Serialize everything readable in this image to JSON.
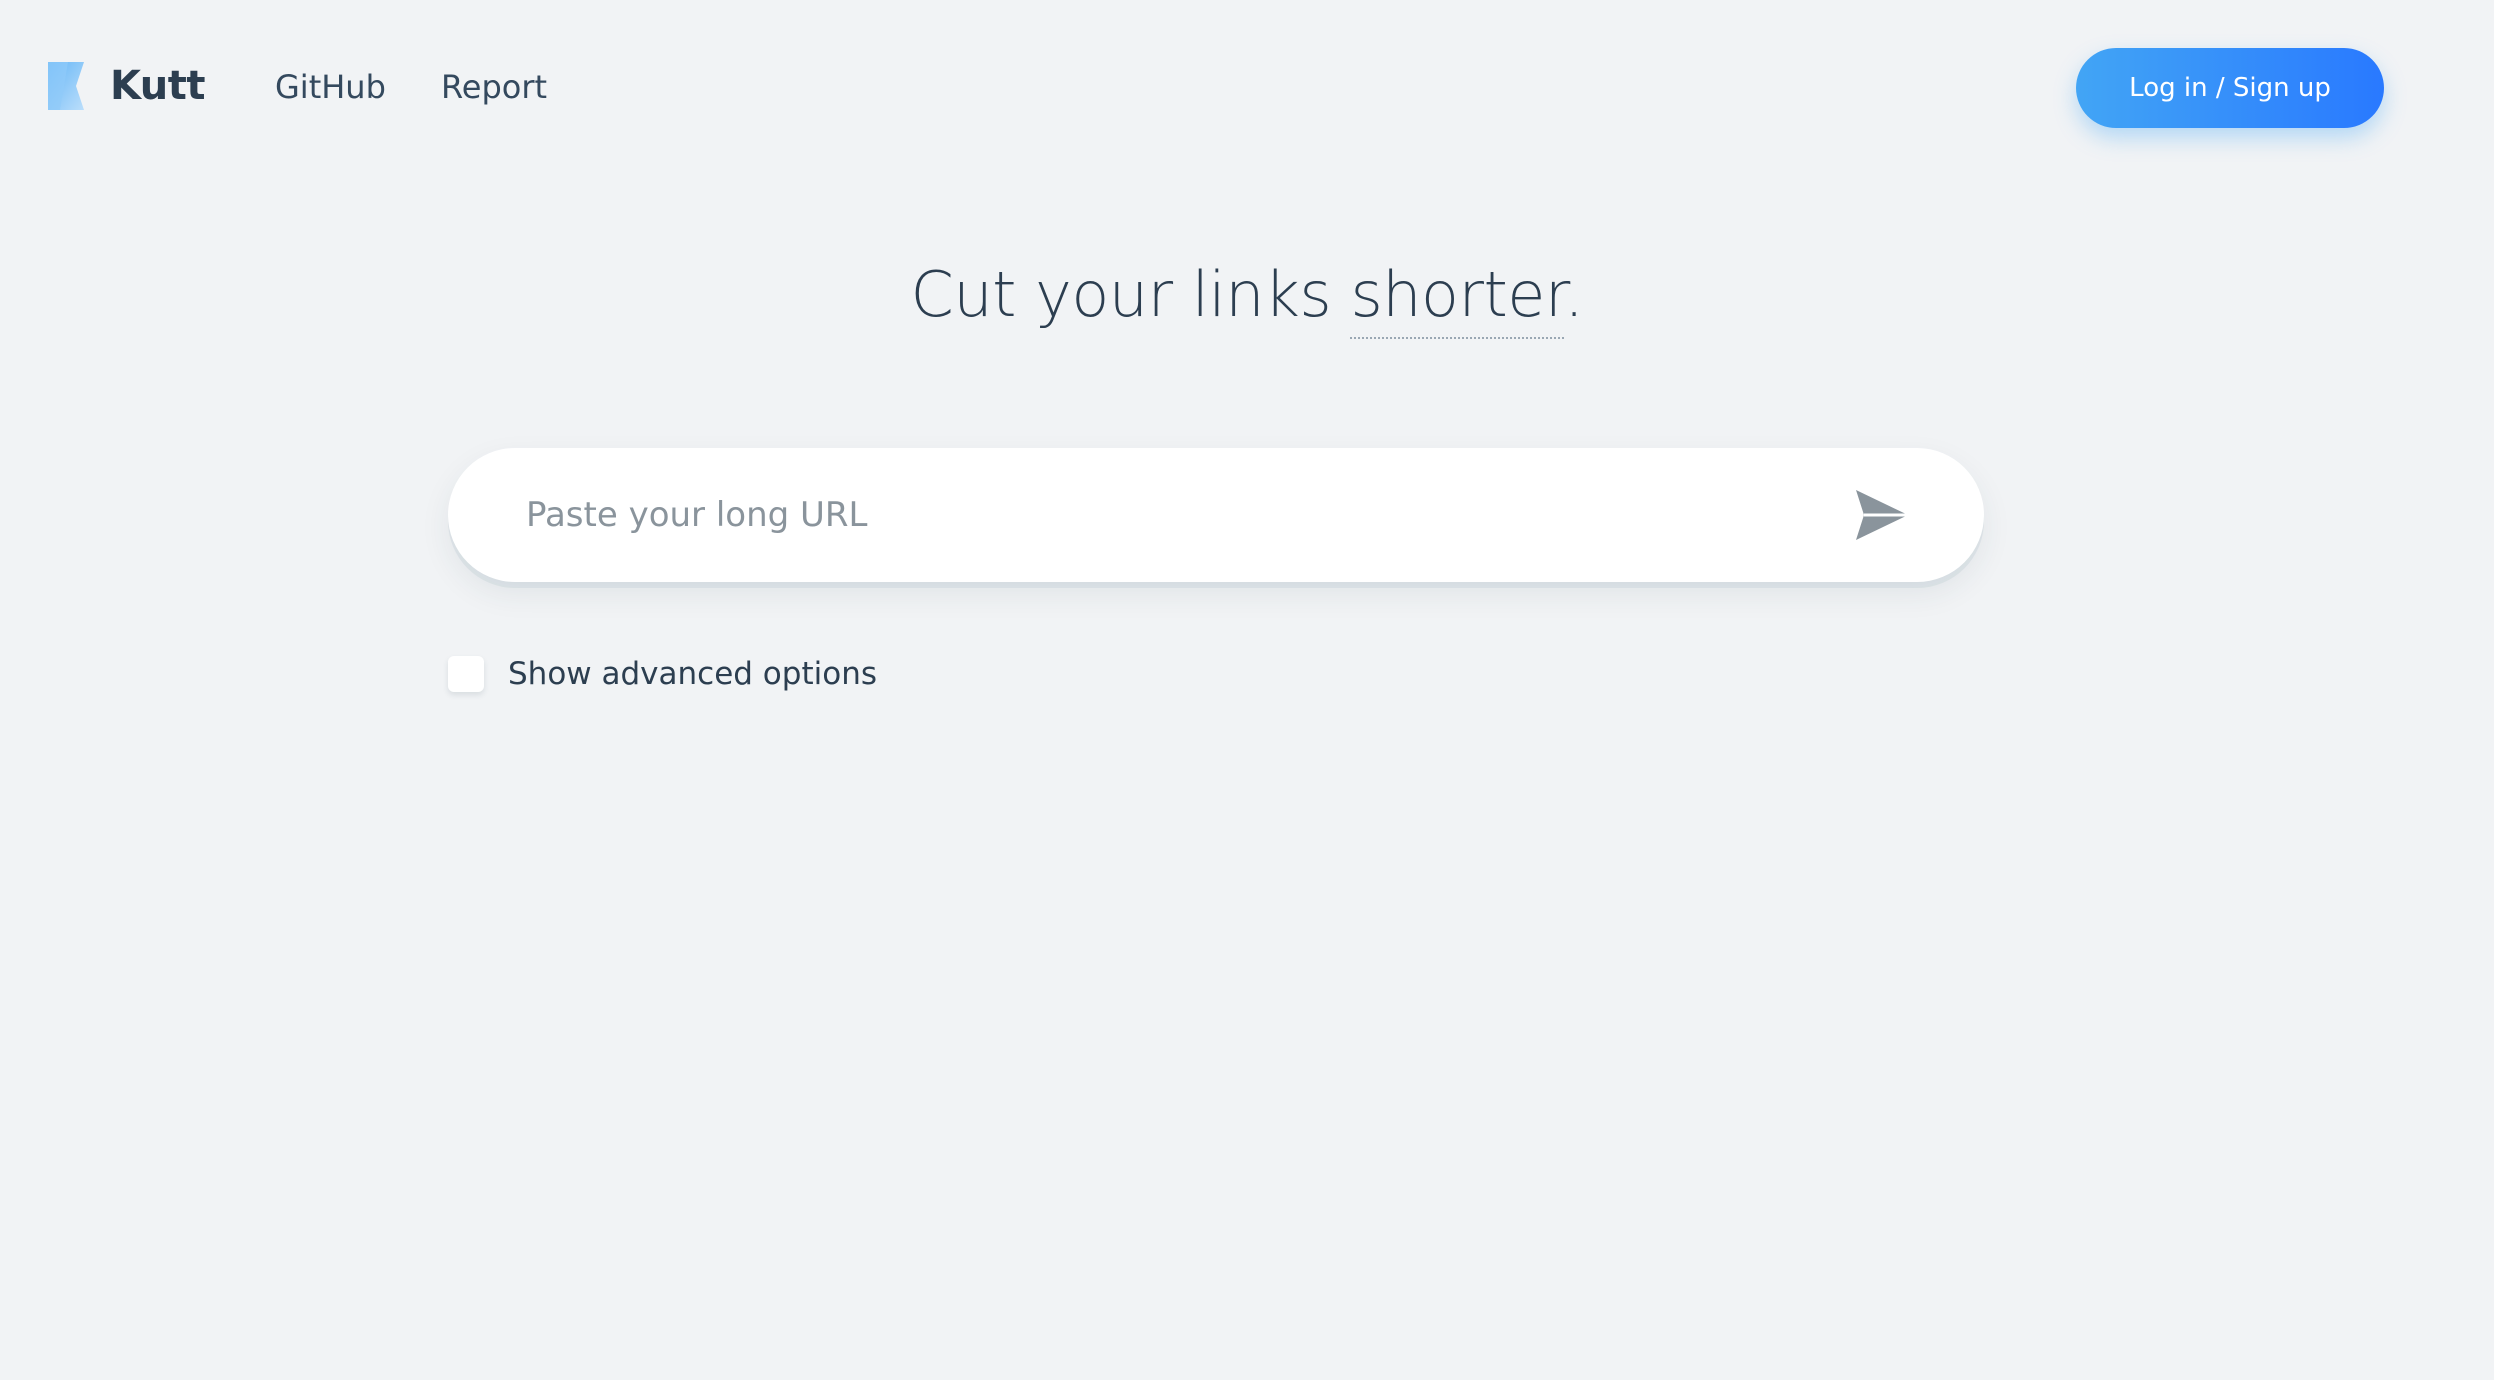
{
  "header": {
    "brand": "Kutt",
    "nav": {
      "github": "GitHub",
      "report": "Report"
    },
    "login_label": "Log in / Sign up"
  },
  "hero": {
    "title_prefix": "Cut your links ",
    "title_emphasis": "shorter",
    "title_suffix": "."
  },
  "shortener": {
    "placeholder": "Paste your long URL",
    "value": "",
    "submit_icon": "send-icon"
  },
  "advanced": {
    "label": "Show advanced options",
    "checked": false
  },
  "colors": {
    "background": "#f1f3f5",
    "accent": "#2979ff",
    "text": "#2c3e50"
  }
}
